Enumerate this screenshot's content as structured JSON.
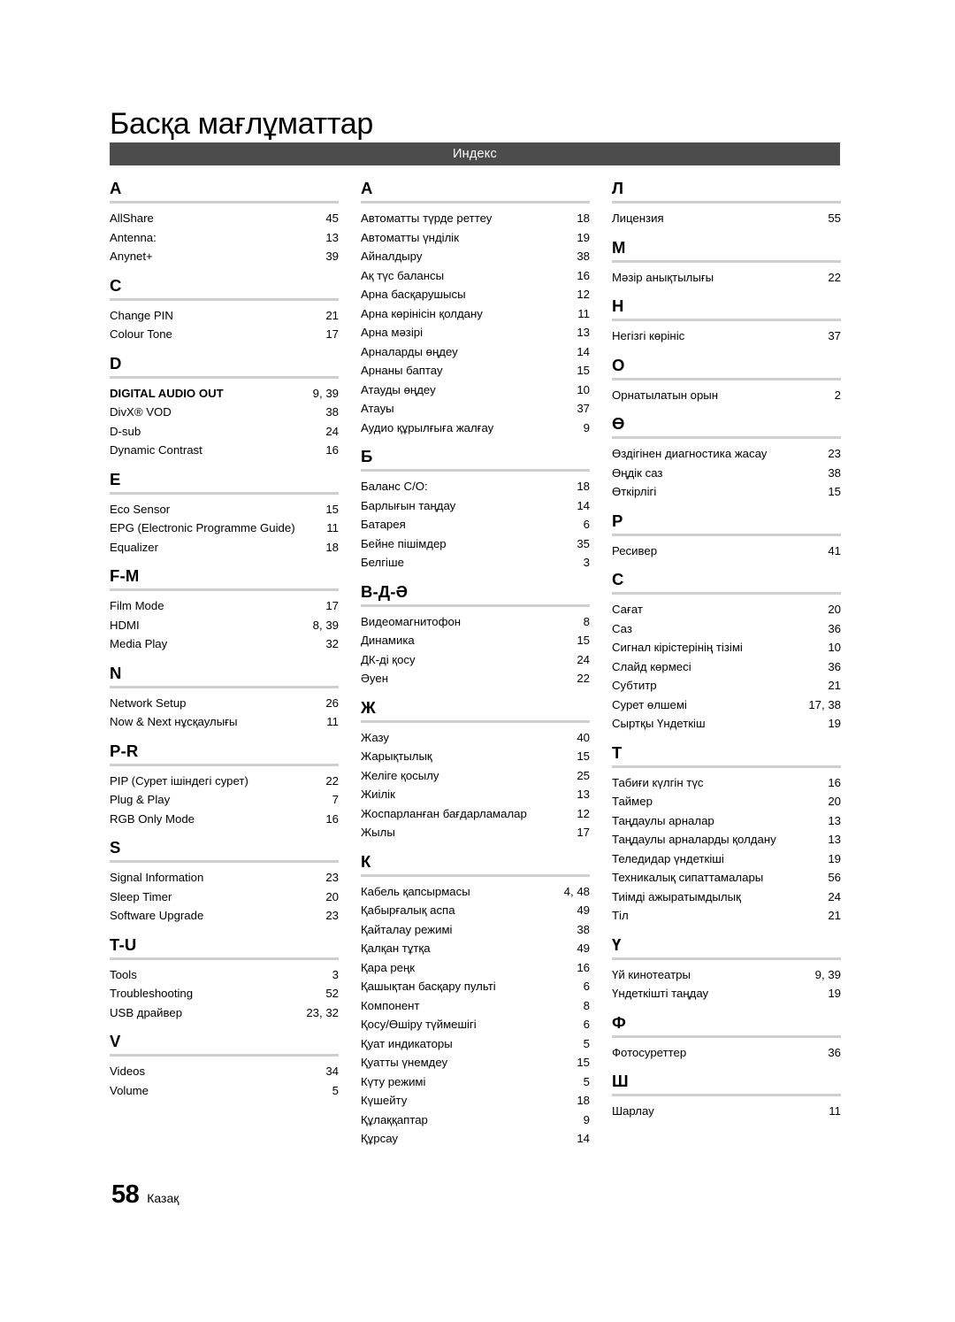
{
  "page": {
    "title": "Басқа мағлұматтар",
    "banner": "Индекс",
    "footer_number": "58",
    "footer_language": "Казақ",
    "banner_color": "#4c4c4c",
    "rule_color": "#cfcfcf"
  },
  "columns": [
    {
      "sections": [
        {
          "letter": "A",
          "entries": [
            {
              "term": "AllShare",
              "page": "45",
              "bold": false
            },
            {
              "term": "Antenna:",
              "page": "13",
              "bold": false
            },
            {
              "term": "Anynet+",
              "page": "39",
              "bold": false
            }
          ]
        },
        {
          "letter": "C",
          "entries": [
            {
              "term": "Change PIN",
              "page": "21",
              "bold": false
            },
            {
              "term": "Colour Tone",
              "page": "17",
              "bold": false
            }
          ]
        },
        {
          "letter": "D",
          "entries": [
            {
              "term": "DIGITAL AUDIO OUT",
              "page": "9, 39",
              "bold": true
            },
            {
              "term": "DivX® VOD",
              "page": "38",
              "bold": false
            },
            {
              "term": "D-sub",
              "page": "24",
              "bold": false
            },
            {
              "term": "Dynamic Contrast",
              "page": "16",
              "bold": false
            }
          ]
        },
        {
          "letter": "E",
          "entries": [
            {
              "term": "Eco Sensor",
              "page": "15",
              "bold": false
            },
            {
              "term": "EPG (Electronic Programme Guide)",
              "page": "11",
              "bold": false
            },
            {
              "term": "Equalizer",
              "page": "18",
              "bold": false
            }
          ]
        },
        {
          "letter": "F-M",
          "entries": [
            {
              "term": "Film Mode",
              "page": "17",
              "bold": false
            },
            {
              "term": "HDMI",
              "page": "8, 39",
              "bold": false
            },
            {
              "term": "Media Play",
              "page": "32",
              "bold": false
            }
          ]
        },
        {
          "letter": "N",
          "entries": [
            {
              "term": "Network Setup",
              "page": "26",
              "bold": false
            },
            {
              "term": "Now & Next нұсқаулығы",
              "page": "11",
              "bold": false
            }
          ]
        },
        {
          "letter": "P-R",
          "entries": [
            {
              "term": "PIP (Сурет ішіндегі сурет)",
              "page": "22",
              "bold": false
            },
            {
              "term": "Plug & Play",
              "page": "7",
              "bold": false
            },
            {
              "term": "RGB Only Mode",
              "page": "16",
              "bold": false
            }
          ]
        },
        {
          "letter": "S",
          "entries": [
            {
              "term": "Signal Information",
              "page": "23",
              "bold": false
            },
            {
              "term": "Sleep Timer",
              "page": "20",
              "bold": false
            },
            {
              "term": "Software Upgrade",
              "page": "23",
              "bold": false
            }
          ]
        },
        {
          "letter": "T-U",
          "entries": [
            {
              "term": "Tools",
              "page": "3",
              "bold": false
            },
            {
              "term": "Troubleshooting",
              "page": "52",
              "bold": false
            },
            {
              "term": "USB драйвер",
              "page": "23, 32",
              "bold": false
            }
          ]
        },
        {
          "letter": "V",
          "entries": [
            {
              "term": "Videos",
              "page": "34",
              "bold": false
            },
            {
              "term": "Volume",
              "page": "5",
              "bold": false
            }
          ]
        }
      ]
    },
    {
      "sections": [
        {
          "letter": "А",
          "entries": [
            {
              "term": "Автоматты түрде реттеу",
              "page": "18",
              "bold": false
            },
            {
              "term": "Автоматты үнділік",
              "page": "19",
              "bold": false
            },
            {
              "term": "Айналдыру",
              "page": "38",
              "bold": false
            },
            {
              "term": "Ақ түс балансы",
              "page": "16",
              "bold": false
            },
            {
              "term": "Арна басқарушысы",
              "page": "12",
              "bold": false
            },
            {
              "term": "Арна көрінісін қолдану",
              "page": "11",
              "bold": false
            },
            {
              "term": "Арна мәзірі",
              "page": "13",
              "bold": false
            },
            {
              "term": "Арналарды өңдеу",
              "page": "14",
              "bold": false
            },
            {
              "term": "Арнаны баптау",
              "page": "15",
              "bold": false
            },
            {
              "term": "Атауды өңдеу",
              "page": "10",
              "bold": false
            },
            {
              "term": "Атауы",
              "page": "37",
              "bold": false
            },
            {
              "term": "Аудио құрылғыға жалғау",
              "page": "9",
              "bold": false
            }
          ]
        },
        {
          "letter": "Б",
          "entries": [
            {
              "term": "Баланс С/О:",
              "page": "18",
              "bold": false
            },
            {
              "term": "Барлығын таңдау",
              "page": "14",
              "bold": false
            },
            {
              "term": "Батарея",
              "page": "6",
              "bold": false
            },
            {
              "term": "Бейне пішімдер",
              "page": "35",
              "bold": false
            },
            {
              "term": "Белгіше",
              "page": "3",
              "bold": false
            }
          ]
        },
        {
          "letter": "В-Д-Ә",
          "entries": [
            {
              "term": "Видеомагнитофон",
              "page": "8",
              "bold": false
            },
            {
              "term": "Динамика",
              "page": "15",
              "bold": false
            },
            {
              "term": "ДК-ді қосу",
              "page": "24",
              "bold": false
            },
            {
              "term": "Әуен",
              "page": "22",
              "bold": false
            }
          ]
        },
        {
          "letter": "Ж",
          "entries": [
            {
              "term": "Жазу",
              "page": "40",
              "bold": false
            },
            {
              "term": "Жарықтылық",
              "page": "15",
              "bold": false
            },
            {
              "term": "Желіге қосылу",
              "page": "25",
              "bold": false
            },
            {
              "term": "Жиілік",
              "page": "13",
              "bold": false
            },
            {
              "term": "Жоспарланған бағдарламалар",
              "page": "12",
              "bold": false
            },
            {
              "term": "Жылы",
              "page": "17",
              "bold": false
            }
          ]
        },
        {
          "letter": "К",
          "entries": [
            {
              "term": "Кабель қапсырмасы",
              "page": "4, 48",
              "bold": false
            },
            {
              "term": "Қабырғалық аспа",
              "page": "49",
              "bold": false
            },
            {
              "term": "Қайталау режимі",
              "page": "38",
              "bold": false
            },
            {
              "term": "Қалқан тұтқа",
              "page": "49",
              "bold": false
            },
            {
              "term": "Қара реңк",
              "page": "16",
              "bold": false
            },
            {
              "term": "Қашықтан басқару пульті",
              "page": "6",
              "bold": false
            },
            {
              "term": "Компонент",
              "page": "8",
              "bold": false
            },
            {
              "term": "Қосу/Өшіру түймешігі",
              "page": "6",
              "bold": false
            },
            {
              "term": "Қуат индикаторы",
              "page": "5",
              "bold": false
            },
            {
              "term": "Қуатты үнемдеу",
              "page": "15",
              "bold": false
            },
            {
              "term": "Күту режимі",
              "page": "5",
              "bold": false
            },
            {
              "term": "Күшейту",
              "page": "18",
              "bold": false
            },
            {
              "term": "Құлаққаптар",
              "page": "9",
              "bold": false
            },
            {
              "term": "Құрсау",
              "page": "14",
              "bold": false
            }
          ]
        }
      ]
    },
    {
      "sections": [
        {
          "letter": "Л",
          "entries": [
            {
              "term": "Лицензия",
              "page": "55",
              "bold": false
            }
          ]
        },
        {
          "letter": "М",
          "entries": [
            {
              "term": "Мәзір анықтылығы",
              "page": "22",
              "bold": false
            }
          ]
        },
        {
          "letter": "Н",
          "entries": [
            {
              "term": "Негізгі көрініс",
              "page": "37",
              "bold": false
            }
          ]
        },
        {
          "letter": "О",
          "entries": [
            {
              "term": "Орнатылатын орын",
              "page": "2",
              "bold": false
            }
          ]
        },
        {
          "letter": "Ө",
          "entries": [
            {
              "term": "Өздігінен диагностика жасау",
              "page": "23",
              "bold": false
            },
            {
              "term": "Өңдік саз",
              "page": "38",
              "bold": false
            },
            {
              "term": "Өткірлігі",
              "page": "15",
              "bold": false
            }
          ]
        },
        {
          "letter": "Р",
          "entries": [
            {
              "term": "Ресивер",
              "page": "41",
              "bold": false
            }
          ]
        },
        {
          "letter": "С",
          "entries": [
            {
              "term": "Сағат",
              "page": "20",
              "bold": false
            },
            {
              "term": "Саз",
              "page": "36",
              "bold": false
            },
            {
              "term": "Сигнал кірістерінің тізімі",
              "page": "10",
              "bold": false
            },
            {
              "term": "Слайд көрмесі",
              "page": "36",
              "bold": false
            },
            {
              "term": "Субтитр",
              "page": "21",
              "bold": false
            },
            {
              "term": "Сурет өлшемі",
              "page": "17, 38",
              "bold": false
            },
            {
              "term": "Сыртқы Үндеткіш",
              "page": "19",
              "bold": false
            }
          ]
        },
        {
          "letter": "Т",
          "entries": [
            {
              "term": "Табиғи күлгін түс",
              "page": "16",
              "bold": false
            },
            {
              "term": "Таймер",
              "page": "20",
              "bold": false
            },
            {
              "term": "Таңдаулы арналар",
              "page": "13",
              "bold": false
            },
            {
              "term": "Таңдаулы арналарды қолдану",
              "page": "13",
              "bold": false
            },
            {
              "term": "Теледидар үндеткіші",
              "page": "19",
              "bold": false
            },
            {
              "term": "Техникалық сипаттамалары",
              "page": "56",
              "bold": false
            },
            {
              "term": "Тиімді ажыратымдылық",
              "page": "24",
              "bold": false
            },
            {
              "term": "Тіл",
              "page": "21",
              "bold": false
            }
          ]
        },
        {
          "letter": "Ү",
          "entries": [
            {
              "term": "Үй кинотеатры",
              "page": "9, 39",
              "bold": false
            },
            {
              "term": "Үндеткішті таңдау",
              "page": "19",
              "bold": false
            }
          ]
        },
        {
          "letter": "Ф",
          "entries": [
            {
              "term": "Фотосуреттер",
              "page": "36",
              "bold": false
            }
          ]
        },
        {
          "letter": "Ш",
          "entries": [
            {
              "term": "Шарлау",
              "page": "11",
              "bold": false
            }
          ]
        }
      ]
    }
  ]
}
